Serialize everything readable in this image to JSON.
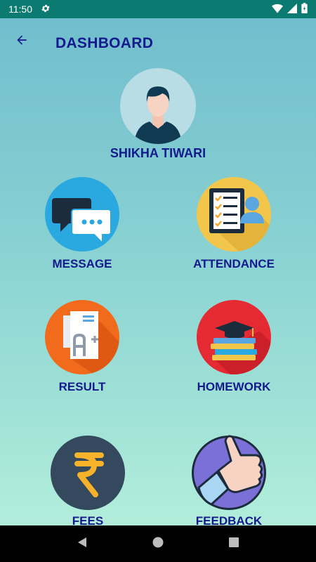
{
  "status_bar": {
    "time": "11:50"
  },
  "app_bar": {
    "title": "DASHBOARD"
  },
  "profile": {
    "name": "SHIKHA TIWARI"
  },
  "tiles": [
    {
      "label": "MESSAGE",
      "icon": "chat-bubbles-icon",
      "color": "#2aa8e0"
    },
    {
      "label": "ATTENDANCE",
      "icon": "attendance-checklist-icon",
      "color": "#f2c64a"
    },
    {
      "label": "RESULT",
      "icon": "result-report-icon",
      "color": "#f26a1b"
    },
    {
      "label": "HOMEWORK",
      "icon": "graduation-books-icon",
      "color": "#e52a33"
    },
    {
      "label": "FEES",
      "icon": "rupee-icon",
      "color": "#34495e"
    },
    {
      "label": "FEEDBACK",
      "icon": "thumbs-up-icon",
      "color": "#7b6fd8"
    }
  ],
  "colors": {
    "title": "#141a8c",
    "status_bar": "#0b7a70"
  }
}
